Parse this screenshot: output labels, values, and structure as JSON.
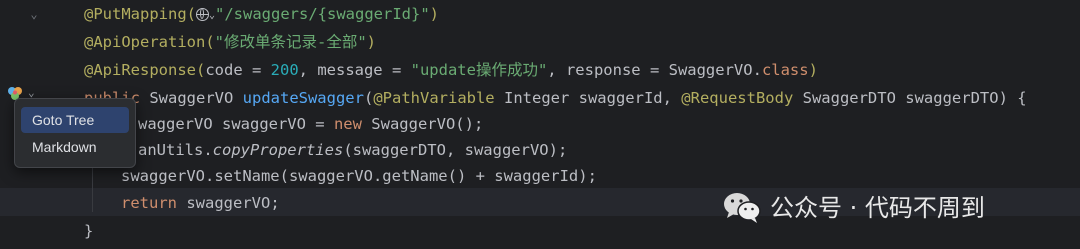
{
  "code": {
    "line1": {
      "annotation": "@PutMapping(",
      "path": "\"/swaggers/{swaggerId}\"",
      "close": ")"
    },
    "line2": {
      "annotation": "@ApiOperation(",
      "value": "\"修改单条记录-全部\"",
      "close": ")"
    },
    "line3": {
      "annotation": "@ApiResponse(",
      "p1": "code = ",
      "code": "200",
      "p2": ", message = ",
      "message": "\"update操作成功\"",
      "p3": ", response = SwaggerVO.",
      "cls": "class",
      "close": ")"
    },
    "line4": {
      "kw": "public",
      "type": " SwaggerVO ",
      "method": "updateSwagger",
      "open": "(",
      "ann1": "@PathVariable",
      "param1": " Integer swaggerId, ",
      "ann2": "@RequestBody",
      "param2": " SwaggerDTO swaggerDTO) {"
    },
    "line5": {
      "pre": "waggerVO swaggerVO = ",
      "kw": "new",
      "post": " SwaggerVO();"
    },
    "line6": {
      "pre": "anUtils.",
      "method": "copyProperties",
      "post": "(swaggerDTO, swaggerVO);"
    },
    "line7": {
      "text": "swaggerVO.setName(swaggerVO.getName() + swaggerId);"
    },
    "line8": {
      "kw": "return",
      "post": " swaggerVO;"
    },
    "line9": {
      "text": "}"
    }
  },
  "popup": {
    "items": [
      {
        "label": "Goto Tree",
        "selected": true
      },
      {
        "label": "Markdown",
        "selected": false
      }
    ]
  },
  "watermark": {
    "text": "公众号 · 代码不周到"
  },
  "colors": {
    "background": "#1e1f22",
    "annotation": "#b3ae60",
    "string": "#6aab73",
    "keyword": "#cf8e6d",
    "number": "#2aacb8",
    "function": "#56a8f5",
    "selection": "#2e436e"
  }
}
